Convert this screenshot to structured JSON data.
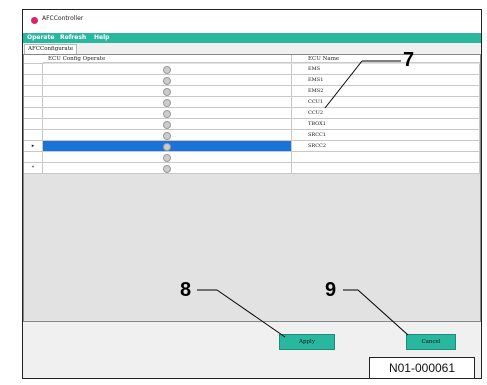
{
  "window": {
    "title": "AFCController"
  },
  "menu": [
    "Operate",
    "Refresh",
    "Help"
  ],
  "tabs": [
    "AFCConfigurate"
  ],
  "table": {
    "columns": [
      "ECU Config Operate",
      "ECU Name"
    ],
    "rows": [
      {
        "marker": "",
        "name": "EMS",
        "selected": false
      },
      {
        "marker": "",
        "name": "EMS1",
        "selected": false
      },
      {
        "marker": "",
        "name": "EMS2",
        "selected": false
      },
      {
        "marker": "",
        "name": "CCU1",
        "selected": false
      },
      {
        "marker": "",
        "name": "CCU2",
        "selected": false
      },
      {
        "marker": "",
        "name": "TBOX1",
        "selected": false
      },
      {
        "marker": "",
        "name": "SRCC1",
        "selected": false
      },
      {
        "marker": "▸",
        "name": "SRCC2",
        "selected": true
      },
      {
        "marker": "",
        "name": "",
        "selected": false
      },
      {
        "marker": "*",
        "name": "",
        "selected": false
      }
    ]
  },
  "buttons": {
    "apply": "Apply",
    "cancel": "Cancel"
  },
  "callouts": {
    "c7": "7",
    "c8": "8",
    "c9": "9"
  },
  "reference": "N01-000061",
  "colors": {
    "menubar": "#2ab79f",
    "selection": "#1a73d9",
    "button": "#2ab79f"
  }
}
